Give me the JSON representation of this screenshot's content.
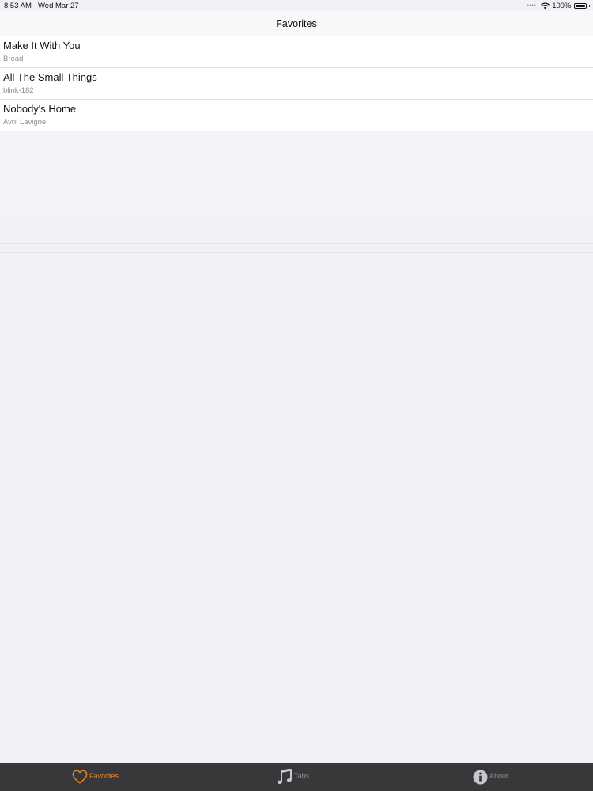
{
  "status_bar": {
    "time": "8:53 AM",
    "date": "Wed Mar 27",
    "battery": "100%",
    "signal_icon": "signal-dots-icon",
    "wifi_icon": "wifi-icon",
    "battery_icon": "battery-icon",
    "battery_level": 1.0
  },
  "nav": {
    "title": "Favorites"
  },
  "songs": [
    {
      "title": "Make It With You",
      "artist": "Bread"
    },
    {
      "title": "All The Small Things",
      "artist": "blink-182"
    },
    {
      "title": "Nobody's Home",
      "artist": "Avril Lavigne"
    }
  ],
  "tab_bar": {
    "items": [
      {
        "label": "Favorites",
        "icon": "heart-icon",
        "selected": true
      },
      {
        "label": "Tabs",
        "icon": "music-note-icon",
        "selected": false
      },
      {
        "label": "About",
        "icon": "info-icon",
        "selected": false
      }
    ],
    "selected_color": "#e8862a",
    "inactive_color": "#8e8e92",
    "background_color": "#38383a"
  }
}
